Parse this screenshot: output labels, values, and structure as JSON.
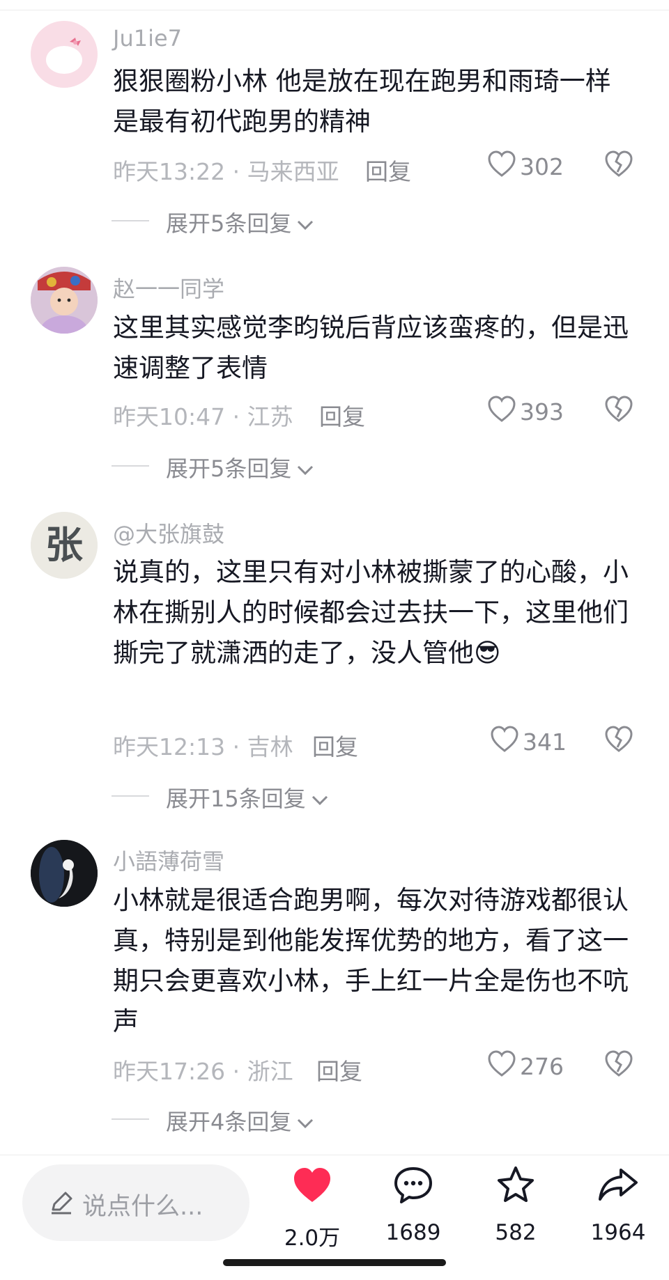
{
  "comments": [
    {
      "username": "Ju1ie7",
      "text": "狠狠圈粉小林 他是放在现在跑男和雨琦一样是最有初代跑男的精神",
      "time_location": "昨天13:22 · 马来西亚",
      "reply_label": "回复",
      "likes": "302",
      "expand_label": "展开5条回复",
      "avatar": "hello-kitty-avatar"
    },
    {
      "username": "赵一一同学",
      "text": "这里其实感觉李昀锐后背应该蛮疼的，但是迅速调整了表情",
      "time_location": "昨天10:47 · 江苏",
      "reply_label": "回复",
      "likes": "393",
      "expand_label": "展开5条回复",
      "avatar": "child-photo-avatar"
    },
    {
      "username": "@大张旗鼓",
      "text": "说真的，这里只有对小林被撕蒙了的心酸，小林在撕别人的时候都会过去扶一下，这里他们撕完了就潇洒的走了，没人管他😎",
      "time_location": "昨天12:13 · 吉林",
      "reply_label": "回复",
      "likes": "341",
      "expand_label": "展开15条回复",
      "avatar": "calligraphy-avatar",
      "avatar_char": "张"
    },
    {
      "username": "小語薄荷雪",
      "text": "小林就是很适合跑男啊，每次对待游戏都很认真，特别是到他能发挥优势的地方，看了这一期只会更喜欢小林，手上红一片全是伤也不吭声",
      "time_location": "昨天17:26 · 浙江",
      "reply_label": "回复",
      "likes": "276",
      "expand_label": "展开4条回复",
      "avatar": "dark-figure-avatar"
    }
  ],
  "bottom_bar": {
    "input_placeholder": "说点什么...",
    "like_count": "2.0万",
    "comment_count": "1689",
    "favorite_count": "582",
    "share_count": "1964"
  },
  "colors": {
    "like_red": "#fe2c55",
    "secondary_text": "#a9abb0",
    "primary_text": "#161823"
  }
}
